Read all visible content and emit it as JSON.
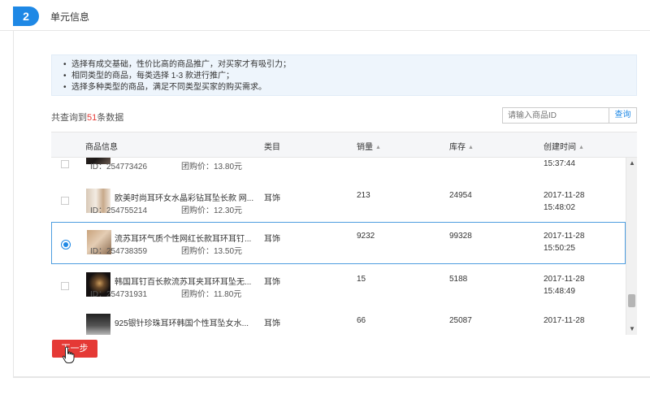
{
  "step": {
    "number": "2",
    "title": "单元信息"
  },
  "tips": [
    "选择有成交基础，性价比高的商品推广，对买家才有吸引力；",
    "相同类型的商品，每类选择 1-3 款进行推广；",
    "选择多种类型的商品，满足不同类型买家的购买需求。"
  ],
  "summary": {
    "prefix": "共查询到",
    "count": "51",
    "suffix": "条数据"
  },
  "search": {
    "placeholder": "请输入商品ID",
    "button": "查询"
  },
  "columns": {
    "info": "商品信息",
    "category": "类目",
    "sales": "销量",
    "stock": "库存",
    "created": "创建时间"
  },
  "rows": [
    {
      "title": "",
      "id": "ID：254773426",
      "price": "团购价：13.80元",
      "category": "",
      "sales": "",
      "stock": "",
      "date": "",
      "time": "15:37:44",
      "selected": false
    },
    {
      "title": "欧美时尚耳环女水晶彩钻耳坠长款 网...",
      "id": "ID：254755214",
      "price": "团购价：12.30元",
      "category": "耳饰",
      "sales": "213",
      "stock": "24954",
      "date": "2017-11-28",
      "time": "15:48:02",
      "selected": false
    },
    {
      "title": "流苏耳环气质个性网红长款耳环耳钉...",
      "id": "ID：254738359",
      "price": "团购价：13.50元",
      "category": "耳饰",
      "sales": "9232",
      "stock": "99328",
      "date": "2017-11-28",
      "time": "15:50:25",
      "selected": true
    },
    {
      "title": "韩国耳钉百长款流苏耳夹耳环耳坠无...",
      "id": "ID：254731931",
      "price": "团购价：11.80元",
      "category": "耳饰",
      "sales": "15",
      "stock": "5188",
      "date": "2017-11-28",
      "time": "15:48:49",
      "selected": false
    },
    {
      "title": "925银针珍珠耳环韩国个性耳坠女水...",
      "id": "",
      "price": "",
      "category": "耳饰",
      "sales": "66",
      "stock": "25087",
      "date": "2017-11-28",
      "time": "",
      "selected": false
    }
  ],
  "next_button": "下一步",
  "colors": {
    "accent": "#1e88e5",
    "danger": "#e53935"
  }
}
